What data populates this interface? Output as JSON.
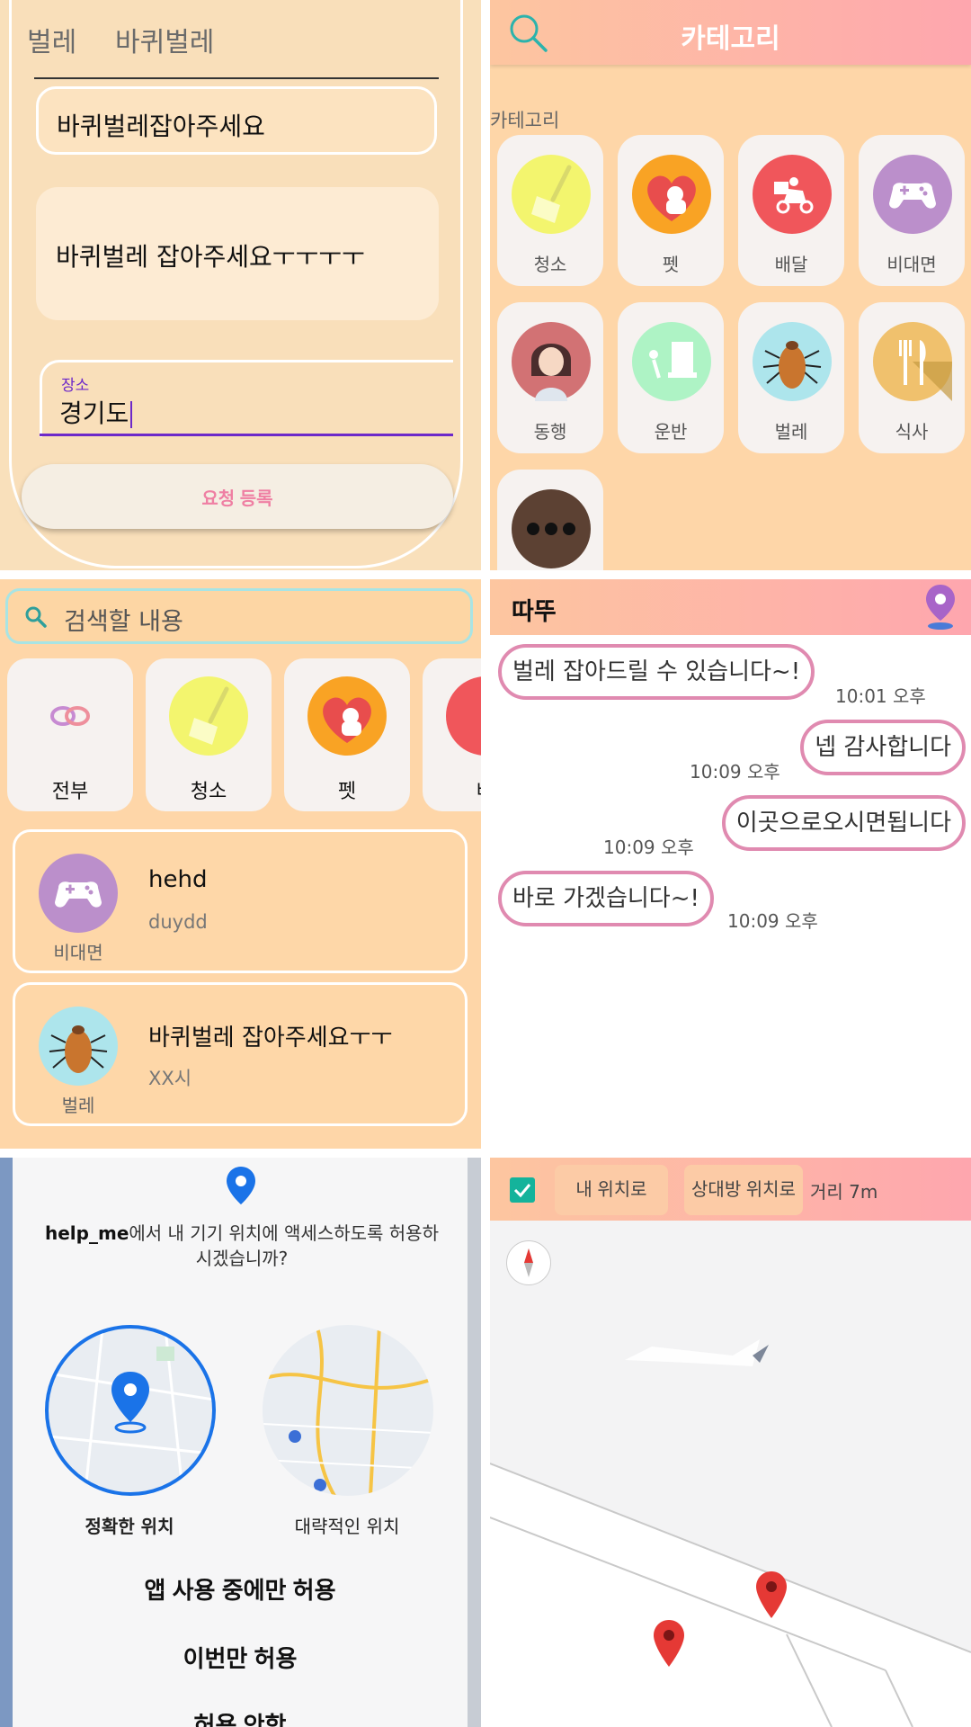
{
  "p1": {
    "tags": [
      "벌레",
      "바퀴벌레"
    ],
    "title_value": "바퀴벌레잡아주세요",
    "description_value": "바퀴벌레 잡아주세요ㅜㅜㅜㅜ",
    "location_label": "장소",
    "location_value": "경기도",
    "submit_label": "요청 등록"
  },
  "p2": {
    "header_title": "카테고리",
    "section_label": "카테고리",
    "categories": [
      {
        "label": "청소",
        "icon": "broom-icon",
        "color": "#f3f56e"
      },
      {
        "label": "펫",
        "icon": "pet-heart-icon",
        "color": "#f9a324"
      },
      {
        "label": "배달",
        "icon": "delivery-scooter-icon",
        "color": "#f0565b"
      },
      {
        "label": "비대면",
        "icon": "gamepad-icon",
        "color": "#bb8fcb"
      },
      {
        "label": "동행",
        "icon": "companion-woman-icon",
        "color": "#d27274"
      },
      {
        "label": "운반",
        "icon": "moving-cart-icon",
        "color": "#aef3c5"
      },
      {
        "label": "벌레",
        "icon": "bug-icon",
        "color": "#ade5ec"
      },
      {
        "label": "식사",
        "icon": "fork-knife-icon",
        "color": "#f0c16d"
      },
      {
        "label": "",
        "icon": "more-dots-icon",
        "color": "#5c4133"
      }
    ]
  },
  "p3": {
    "search_placeholder": "검색할 내용",
    "filters": [
      {
        "label": "전부",
        "icon": "link-rings-icon"
      },
      {
        "label": "청소",
        "icon": "broom-icon"
      },
      {
        "label": "펫",
        "icon": "pet-heart-icon"
      },
      {
        "label": "배",
        "icon": "delivery-scooter-icon"
      }
    ],
    "items": [
      {
        "title": "hehd",
        "subtitle": "duydd",
        "category": "비대면",
        "icon": "gamepad-icon"
      },
      {
        "title": "바퀴벌레 잡아주세요ㅜㅜ",
        "subtitle": "XX시",
        "category": "벌레",
        "icon": "bug-icon"
      }
    ]
  },
  "p4": {
    "chat_name": "따뚜",
    "messages": [
      {
        "text": "벌레 잡아드릴 수 있습니다~!",
        "time": "10:01 오후",
        "side": "left"
      },
      {
        "text": "넵 감사합니다",
        "time": "10:09 오후",
        "side": "right"
      },
      {
        "text": "이곳으로오시면됩니다",
        "time": "10:09 오후",
        "side": "right"
      },
      {
        "text": "바로 가겠습니다~!",
        "time": "10:09 오후",
        "side": "left"
      }
    ]
  },
  "p5": {
    "app_name": "help_me",
    "question_rest": "에서 내 기기 위치에 액세스하도록 허용하시겠습니까?",
    "precise_label": "정확한 위치",
    "approx_label": "대략적인 위치",
    "btn_while_using": "앱 사용 중에만 허용",
    "btn_once": "이번만 허용",
    "btn_deny": "허용 안함"
  },
  "p6": {
    "btn_my_location": "내 위치로",
    "btn_partner_location": "상대방 위치로",
    "distance": "거리 7m"
  }
}
